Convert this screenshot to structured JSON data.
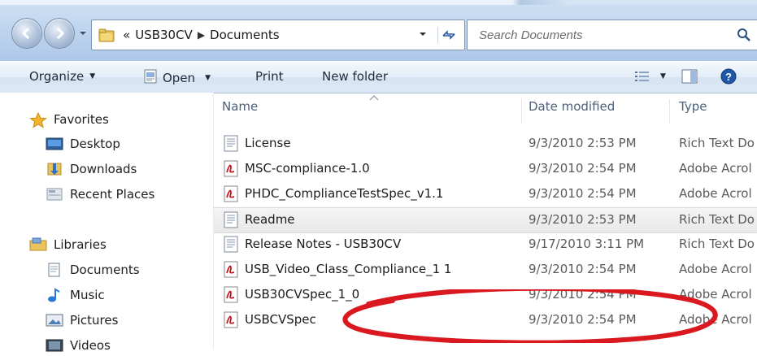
{
  "window": {
    "address": {
      "crumbs": [
        "USB30CV",
        "Documents"
      ],
      "overflow_glyph": "«"
    },
    "search": {
      "placeholder": "Search Documents"
    }
  },
  "toolbar": {
    "organize_label": "Organize",
    "open_label": "Open",
    "print_label": "Print",
    "new_folder_label": "New folder"
  },
  "sidebar": {
    "favorites_label": "Favorites",
    "favorites": [
      {
        "label": "Desktop",
        "icon": "desktop-icon"
      },
      {
        "label": "Downloads",
        "icon": "downloads-icon"
      },
      {
        "label": "Recent Places",
        "icon": "recent-places-icon"
      }
    ],
    "libraries_label": "Libraries",
    "libraries": [
      {
        "label": "Documents",
        "icon": "documents-library-icon"
      },
      {
        "label": "Music",
        "icon": "music-icon"
      },
      {
        "label": "Pictures",
        "icon": "pictures-icon"
      },
      {
        "label": "Videos",
        "icon": "videos-icon"
      }
    ]
  },
  "columns": {
    "name": "Name",
    "date": "Date modified",
    "type": "Type"
  },
  "files": [
    {
      "name": "License",
      "date": "9/3/2010 2:53 PM",
      "type": "Rich Text Do",
      "icon": "rtf-icon"
    },
    {
      "name": "MSC-compliance-1.0",
      "date": "9/3/2010 2:54 PM",
      "type": "Adobe Acrol",
      "icon": "pdf-icon"
    },
    {
      "name": "PHDC_ComplianceTestSpec_v1.1",
      "date": "9/3/2010 2:54 PM",
      "type": "Adobe Acrol",
      "icon": "pdf-icon"
    },
    {
      "name": "Readme",
      "date": "9/3/2010 2:53 PM",
      "type": "Rich Text Do",
      "icon": "rtf-icon",
      "selected": true
    },
    {
      "name": "Release Notes - USB30CV",
      "date": "9/17/2010 3:11 PM",
      "type": "Rich Text Do",
      "icon": "rtf-icon"
    },
    {
      "name": "USB_Video_Class_Compliance_1 1",
      "date": "9/3/2010 2:54 PM",
      "type": "Adobe Acrol",
      "icon": "pdf-icon"
    },
    {
      "name": "USB30CVSpec_1_0",
      "date": "9/3/2010 2:54 PM",
      "type": "Adobe Acrol",
      "icon": "pdf-icon"
    },
    {
      "name": "USBCVSpec",
      "date": "9/3/2010 2:54 PM",
      "type": "Adobe Acrol",
      "icon": "pdf-icon"
    }
  ],
  "annotation": {
    "color": "#d9191f",
    "shape": "ellipse around Readme row"
  },
  "colors": {
    "accent": "#3a7bd5",
    "header_text": "#4c607a",
    "annotation": "#d9191f"
  }
}
